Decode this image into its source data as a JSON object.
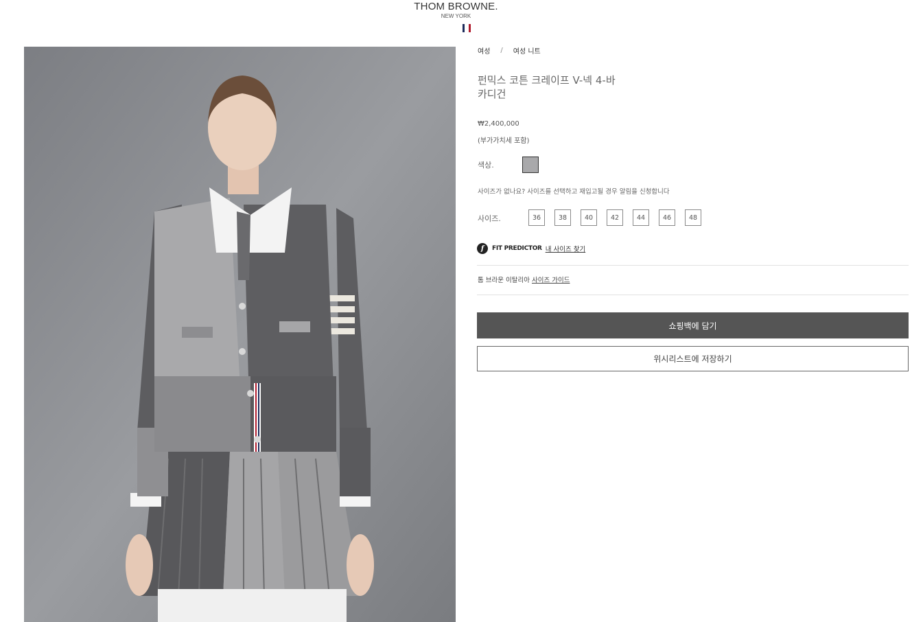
{
  "header": {
    "brand": "THOM BROWNE.",
    "city": "NEW YORK",
    "flag_colors": [
      "#1c2a5a",
      "#ffffff",
      "#b01c2e"
    ]
  },
  "breadcrumb": {
    "items": [
      "여성",
      "여성 니트"
    ],
    "separator": "/"
  },
  "product": {
    "title_line1": "펀믹스 코튼 크레이프 V-넥 4-바",
    "title_line2": "카디건",
    "price": "₩2,400,000",
    "vat_note": "(부가가치세 포함)",
    "image_alt": "product-photo"
  },
  "color": {
    "label": "색상.",
    "selected_swatch": "#a9a9ab"
  },
  "size": {
    "notify_text": "사이즈가 없나요? 사이즈를 선택하고 재입고될 경우 알림을 신청합니다",
    "label": "사이즈.",
    "options": [
      "36",
      "38",
      "40",
      "42",
      "44",
      "46",
      "48"
    ]
  },
  "fit_predictor": {
    "icon": "f",
    "label": "FIT PREDICTOR",
    "link": "내 사이즈 찾기"
  },
  "size_guide": {
    "prefix": "톰 브라운 이탈리아",
    "link": "사이즈 가이드"
  },
  "actions": {
    "add_to_cart": "쇼핑백에 담기",
    "add_to_wishlist": "위시리스트에 저장하기"
  },
  "colors": {
    "button_dark": "#555555",
    "page_bg": "#ffffff"
  }
}
